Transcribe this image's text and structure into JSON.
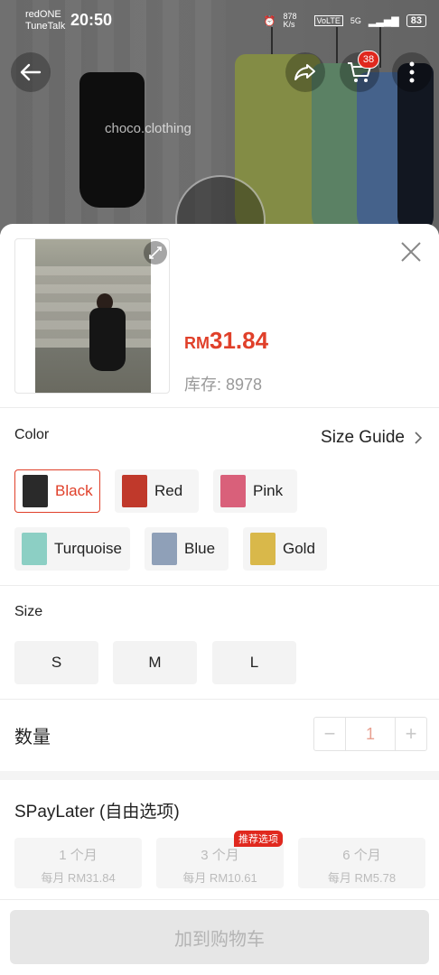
{
  "status_bar": {
    "carrier_line1": "redONE",
    "carrier_line2": "TuneTalk",
    "time": "20:50",
    "net_speed": "878 K/s",
    "volte": "VoLTE",
    "network": "5G",
    "battery": "83"
  },
  "banner": {
    "watermark": "choco.clothing",
    "cart_count": "38"
  },
  "product": {
    "currency": "RM",
    "price": "31.84",
    "stock_text": "库存: 8978"
  },
  "color_section": {
    "label": "Color",
    "size_guide": "Size Guide",
    "options": [
      {
        "label": "Black",
        "selected": true,
        "swatch": "#2a2a2a"
      },
      {
        "label": "Red",
        "selected": false,
        "swatch": "#c0392b"
      },
      {
        "label": "Pink",
        "selected": false,
        "swatch": "#d9607a"
      },
      {
        "label": "Turquoise",
        "selected": false,
        "swatch": "#8ccfc4"
      },
      {
        "label": "Blue",
        "selected": false,
        "swatch": "#8fa0b8"
      },
      {
        "label": "Gold",
        "selected": false,
        "swatch": "#d9b84a"
      }
    ]
  },
  "size_section": {
    "label": "Size",
    "options": [
      "S",
      "M",
      "L"
    ]
  },
  "quantity": {
    "label": "数量",
    "minus": "−",
    "value": "1",
    "plus": "+"
  },
  "spaylater": {
    "title": "SPayLater (自由选项)",
    "badge": "推荐选项",
    "plans": [
      {
        "term": "1 个月",
        "monthly": "每月 RM31.84"
      },
      {
        "term": "3 个月",
        "monthly": "每月 RM10.61"
      },
      {
        "term": "6 个月",
        "monthly": "每月 RM5.78"
      }
    ]
  },
  "add_to_cart": "加到购物车",
  "colors": {
    "accent": "#e0402a",
    "badge_red": "#e0281e"
  }
}
